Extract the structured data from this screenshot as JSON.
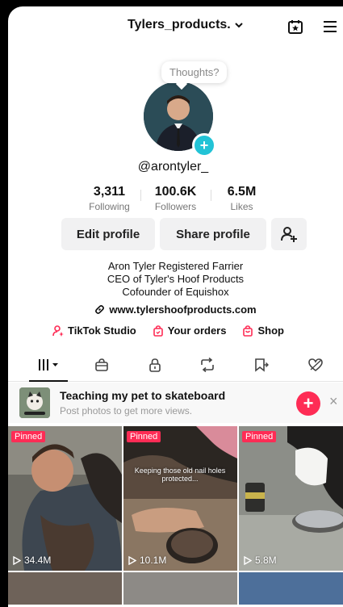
{
  "header": {
    "account_name": "Tylers_products.",
    "icons": [
      "chevron-down-icon",
      "calendar-star-icon",
      "menu-icon"
    ]
  },
  "profile": {
    "thought_bubble": "Thoughts?",
    "handle": "@arontyler_",
    "stats": [
      {
        "value": "3,311",
        "label": "Following"
      },
      {
        "value": "100.6K",
        "label": "Followers"
      },
      {
        "value": "6.5M",
        "label": "Likes"
      }
    ],
    "buttons": {
      "edit": "Edit profile",
      "share": "Share profile"
    },
    "bio_lines": [
      "Aron Tyler Registered Farrier",
      "CEO of Tyler's Hoof Products",
      "Cofounder of Equishox"
    ],
    "website": "www.tylershoofproducts.com",
    "quick_links": [
      "TikTok Studio",
      "Your orders",
      "Shop"
    ]
  },
  "tabs": [
    "videos-tab",
    "shop-tab",
    "private-tab",
    "reposts-tab",
    "favorites-tab",
    "liked-tab"
  ],
  "promo": {
    "title": "Teaching my pet to skateboard",
    "subtitle": "Post photos to get more views."
  },
  "videos": [
    {
      "pinned": "Pinned",
      "views": "34.4M"
    },
    {
      "pinned": "Pinned",
      "views": "10.1M",
      "caption": "Keeping those old nail holes protected..."
    },
    {
      "pinned": "Pinned",
      "views": "5.8M"
    }
  ],
  "colors": {
    "accent": "#fe2c55",
    "badge": "#22c3d6"
  }
}
